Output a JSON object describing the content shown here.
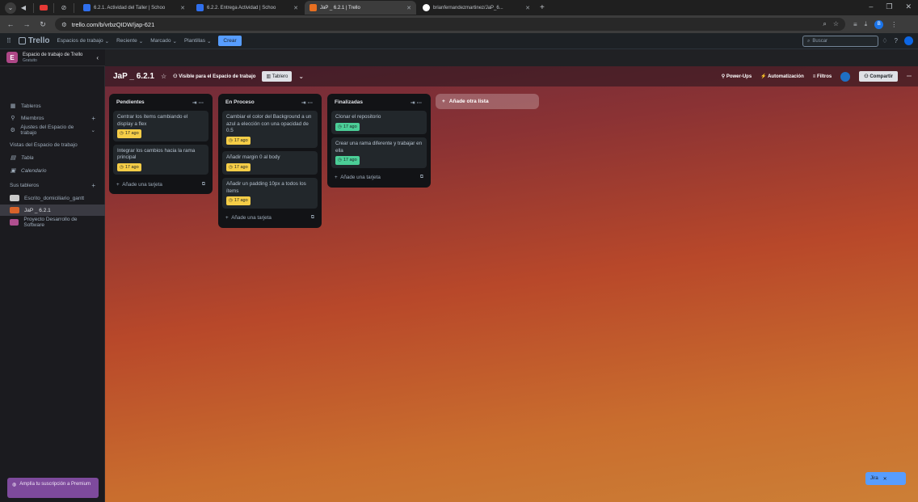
{
  "browser": {
    "tabs": [
      {
        "title": "6.2.1. Actividad del Taller | Schoo",
        "favicon_color": "#2f6fed"
      },
      {
        "title": "6.2.2. Entrega Actividad | Schoo",
        "favicon_color": "#2f6fed"
      },
      {
        "title": "JaP _ 6.2.1 | Trello",
        "favicon_color": "#e76f21"
      },
      {
        "title": "brianfernandezmartinez/JaP_6...",
        "favicon_color": "#ffffff"
      }
    ],
    "url": "trello.com/b/vrbzQIDW/jap-621"
  },
  "trello_header": {
    "logo": "Trello",
    "nav": [
      "Espacios de trabajo",
      "Reciente",
      "Marcado",
      "Plantillas"
    ],
    "create": "Crear",
    "search_placeholder": "Buscar"
  },
  "sidebar": {
    "workspace_letter": "E",
    "workspace_name": "Espacio de trabajo de Trello",
    "workspace_plan": "Gratuito",
    "items": [
      {
        "label": "Tableros",
        "icon": "board-icon"
      },
      {
        "label": "Miembros",
        "icon": "person-icon"
      },
      {
        "label": "Ajustes del Espacio de trabajo",
        "icon": "gear-icon"
      }
    ],
    "views_heading": "Vistas del Espacio de trabajo",
    "views": [
      {
        "label": "Tabla",
        "icon": "table-icon"
      },
      {
        "label": "Calendario",
        "icon": "calendar-icon"
      }
    ],
    "boards_heading": "Sus tableros",
    "boards": [
      {
        "label": "Escrito_domiciliario_gantt",
        "color": "#c9c9c9"
      },
      {
        "label": "JaP _ 6.2.1",
        "color": "#d8632a"
      },
      {
        "label": "Proyecto Desarrollo de Software",
        "color": "#b04f8f"
      }
    ],
    "premium": "Amplía tu suscripción a Premium"
  },
  "board": {
    "title": "JaP _ 6.2.1",
    "visibility": "Visible para el Espacio de trabajo",
    "view": "Tablero",
    "powerups": "Power-Ups",
    "automation": "Automatización",
    "filters": "Filtros",
    "share": "Compartir",
    "add_list": "Añade otra lista",
    "lists": [
      {
        "title": "Pendientes",
        "cards": [
          {
            "text": "Centrar los ítems cambiando el display a flex",
            "due": "17 ago",
            "due_color": "yellow"
          },
          {
            "text": "Integrar los cambios hacia la rama principal",
            "due": "17 ago",
            "due_color": "yellow"
          }
        ],
        "add_card": "Añade una tarjeta"
      },
      {
        "title": "En Proceso",
        "cards": [
          {
            "text": "Cambiar el color del Background a un azul a elección con una opacidad de 0.5",
            "due": "17 ago",
            "due_color": "yellow"
          },
          {
            "text": "Añadir margin 0 al body",
            "due": "17 ago",
            "due_color": "yellow"
          },
          {
            "text": "Añadir un padding 10px a todos los ítems",
            "due": "17 ago",
            "due_color": "yellow"
          }
        ],
        "add_card": "Añade una tarjeta"
      },
      {
        "title": "Finalizadas",
        "cards": [
          {
            "text": "Clonar el repositorio",
            "due": "17 ago",
            "due_color": "green"
          },
          {
            "text": "Crear una rama diferente y trabajar en ella",
            "due": "17 ago",
            "due_color": "green"
          }
        ],
        "add_card": "Añade una tarjeta"
      }
    ],
    "jira": "Jira"
  }
}
